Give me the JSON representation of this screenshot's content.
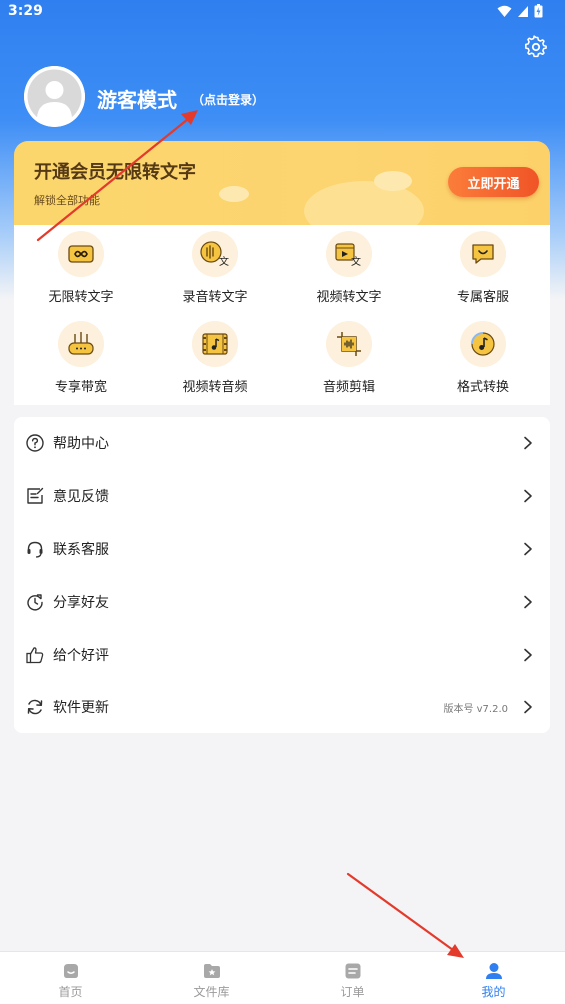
{
  "status_bar": {
    "time": "3:29"
  },
  "profile": {
    "username": "游客模式",
    "login_hint": "（点击登录）"
  },
  "vip": {
    "title": "开通会员无限转文字",
    "subtitle": "解锁全部功能",
    "button": "立即开通"
  },
  "features": [
    {
      "label": "无限转文字",
      "icon": "infinity-icon"
    },
    {
      "label": "录音转文字",
      "icon": "voice-to-text-icon"
    },
    {
      "label": "视频转文字",
      "icon": "video-to-text-icon"
    },
    {
      "label": "专属客服",
      "icon": "service-chat-icon"
    },
    {
      "label": "专享带宽",
      "icon": "router-icon"
    },
    {
      "label": "视频转音频",
      "icon": "film-music-icon"
    },
    {
      "label": "音频剪辑",
      "icon": "audio-crop-icon"
    },
    {
      "label": "格式转换",
      "icon": "music-convert-icon"
    }
  ],
  "menu": [
    {
      "label": "帮助中心",
      "icon": "help-icon"
    },
    {
      "label": "意见反馈",
      "icon": "feedback-icon"
    },
    {
      "label": "联系客服",
      "icon": "headset-icon"
    },
    {
      "label": "分享好友",
      "icon": "share-icon"
    },
    {
      "label": "给个好评",
      "icon": "thumbs-up-icon"
    },
    {
      "label": "软件更新",
      "icon": "refresh-icon",
      "extra": "版本号 v7.2.0"
    }
  ],
  "tabs": [
    {
      "label": "首页",
      "icon": "home-icon"
    },
    {
      "label": "文件库",
      "icon": "folder-icon"
    },
    {
      "label": "订单",
      "icon": "order-icon"
    },
    {
      "label": "我的",
      "icon": "user-icon",
      "active": true
    }
  ],
  "colors": {
    "accent": "#2f7ff0",
    "vip_gold": "#fcd470",
    "vip_button": "#f05427",
    "annotation_arrow": "#e33a2c"
  }
}
